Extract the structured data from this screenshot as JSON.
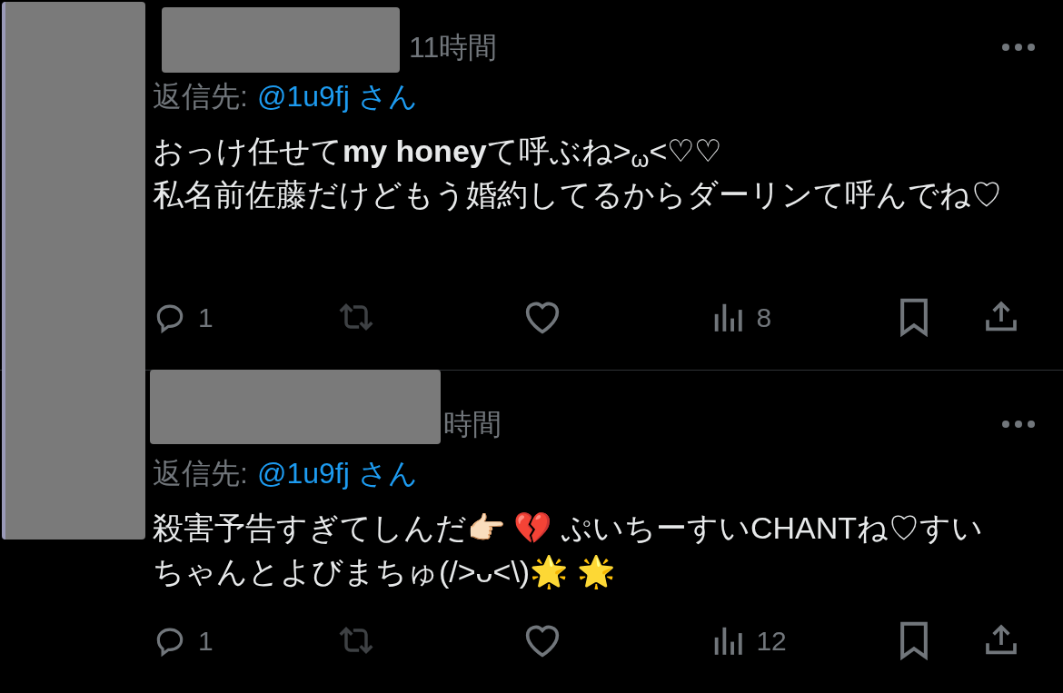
{
  "tweets": [
    {
      "time": "11時間",
      "reply_to_label": "返信先:",
      "reply_to_handle": "@1u9fj さん",
      "paragraphs": [
        "おっけ任せて**my honey**て呼ぶね>$_{ω}$<♡♡",
        "私名前佐藤だけどもう婚約してるからダーリンて呼んでね♡"
      ],
      "actions": [
        {
          "kind": "reply",
          "count": "1",
          "disabled": false
        },
        {
          "kind": "retweet",
          "disabled": true
        },
        {
          "kind": "like",
          "disabled": false
        },
        {
          "kind": "views",
          "count": "8",
          "disabled": false
        },
        {
          "kind": "bookmark",
          "disabled": false
        },
        {
          "kind": "share",
          "disabled": false
        }
      ]
    },
    {
      "time": "時間",
      "reply_to_label": "返信先:",
      "reply_to_handle": "@1u9fj さん",
      "paragraphs": [
        "殺害予告すぎてしんだ👉🏻 💔 ぷいちーすいCHANTね♡すいちゃんとよびまちゅ(/>ᴗ<\\)🌟 🌟"
      ],
      "actions": [
        {
          "kind": "reply",
          "count": "1",
          "disabled": false
        },
        {
          "kind": "retweet",
          "disabled": true
        },
        {
          "kind": "like",
          "disabled": false
        },
        {
          "kind": "views",
          "count": "12",
          "disabled": false
        },
        {
          "kind": "bookmark",
          "disabled": false
        },
        {
          "kind": "share",
          "disabled": false
        }
      ]
    }
  ]
}
